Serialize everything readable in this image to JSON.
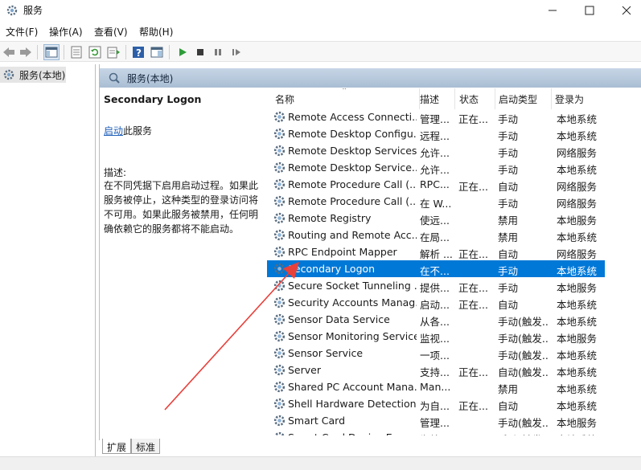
{
  "window": {
    "title": "服务",
    "icon": "gear-icon"
  },
  "menu": [
    "文件(F)",
    "操作(A)",
    "查看(V)",
    "帮助(H)"
  ],
  "tree": {
    "root_label": "服务(本地)"
  },
  "main": {
    "header_label": "服务(本地)",
    "selected_service": "Secondary Logon",
    "action_link": "启动",
    "action_suffix": "此服务",
    "description_label": "描述:",
    "description": "在不同凭据下启用启动过程。如果此服务被停止，这种类型的登录访问将不可用。如果此服务被禁用，任何明确依赖它的服务都将不能启动。"
  },
  "columns": {
    "name": "名称",
    "desc": "描述",
    "status": "状态",
    "stype": "启动类型",
    "logon": "登录为"
  },
  "services": [
    {
      "name": "Remote Access Connecti...",
      "desc": "管理...",
      "status": "正在...",
      "stype": "手动",
      "logon": "本地系统"
    },
    {
      "name": "Remote Desktop Configu...",
      "desc": "远程...",
      "status": "",
      "stype": "手动",
      "logon": "本地系统"
    },
    {
      "name": "Remote Desktop Services",
      "desc": "允许...",
      "status": "",
      "stype": "手动",
      "logon": "网络服务"
    },
    {
      "name": "Remote Desktop Service...",
      "desc": "允许...",
      "status": "",
      "stype": "手动",
      "logon": "本地系统"
    },
    {
      "name": "Remote Procedure Call (...",
      "desc": "RPC...",
      "status": "正在...",
      "stype": "自动",
      "logon": "网络服务"
    },
    {
      "name": "Remote Procedure Call (...",
      "desc": "在 W...",
      "status": "",
      "stype": "手动",
      "logon": "网络服务"
    },
    {
      "name": "Remote Registry",
      "desc": "使远...",
      "status": "",
      "stype": "禁用",
      "logon": "本地服务"
    },
    {
      "name": "Routing and Remote Acc...",
      "desc": "在局...",
      "status": "",
      "stype": "禁用",
      "logon": "本地系统"
    },
    {
      "name": "RPC Endpoint Mapper",
      "desc": "解析 ...",
      "status": "正在...",
      "stype": "自动",
      "logon": "网络服务"
    },
    {
      "name": "Secondary Logon",
      "desc": "在不...",
      "status": "",
      "stype": "手动",
      "logon": "本地系统",
      "selected": true
    },
    {
      "name": "Secure Socket Tunneling ...",
      "desc": "提供...",
      "status": "正在...",
      "stype": "手动",
      "logon": "本地服务"
    },
    {
      "name": "Security Accounts Manag...",
      "desc": "启动...",
      "status": "正在...",
      "stype": "自动",
      "logon": "本地系统"
    },
    {
      "name": "Sensor Data Service",
      "desc": "从各...",
      "status": "",
      "stype": "手动(触发...",
      "logon": "本地系统"
    },
    {
      "name": "Sensor Monitoring Service",
      "desc": "监视...",
      "status": "",
      "stype": "手动(触发...",
      "logon": "本地服务"
    },
    {
      "name": "Sensor Service",
      "desc": "一项...",
      "status": "",
      "stype": "手动(触发...",
      "logon": "本地系统"
    },
    {
      "name": "Server",
      "desc": "支持...",
      "status": "正在...",
      "stype": "自动(触发...",
      "logon": "本地系统"
    },
    {
      "name": "Shared PC Account Mana...",
      "desc": "Man...",
      "status": "",
      "stype": "禁用",
      "logon": "本地系统"
    },
    {
      "name": "Shell Hardware Detection",
      "desc": "为自...",
      "status": "正在...",
      "stype": "自动",
      "logon": "本地系统"
    },
    {
      "name": "Smart Card",
      "desc": "管理...",
      "status": "",
      "stype": "手动(触发...",
      "logon": "本地服务"
    },
    {
      "name": "Smart Card Device Enum...",
      "desc": "为给...",
      "status": "",
      "stype": "手动(触发...",
      "logon": "本地系统"
    }
  ],
  "tabs": [
    "扩展",
    "标准"
  ],
  "colors": {
    "selection": "#0078d7",
    "link": "#1f5fb8",
    "annotation": "#e8403a",
    "header_gradient_top": "#c7d6e6",
    "header_gradient_bottom": "#a9bed3"
  }
}
